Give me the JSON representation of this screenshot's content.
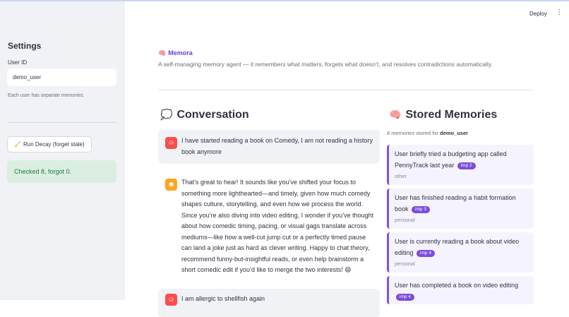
{
  "sidebar": {
    "title": "Settings",
    "user_id_label": "User ID",
    "user_id_value": "demo_user",
    "help_text": "Each user has separate memories.",
    "decay_button_icon": "broom-icon",
    "decay_button_label": "Run Decay (forget stale)",
    "success_message": "Checked 8, forgot 0."
  },
  "header": {
    "deploy_label": "Deploy",
    "menu_glyph": "⋮",
    "brand_icon": "brain-icon",
    "brand_name": "Memora",
    "tagline": "A self-managing memory agent — it remembers what matters, forgets what doesn’t, and resolves contradictions automatically."
  },
  "conversation": {
    "title": "Conversation",
    "icon": "speech-bubble-icon",
    "messages": [
      {
        "role": "user",
        "text": "I have started reading a book on Comedy, I am not reading a history book anymore"
      },
      {
        "role": "assistant",
        "text": "That’s great to hear! It sounds like you’ve shifted your focus to something more lighthearted—and timely, given how much comedy shapes culture, storytelling, and even how we process the world. Since you’re also diving into video editing, I wonder if you’ve thought about how comedic timing, pacing, or visual gags translate across mediums—like how a well-cut jump cut or a perfectly timed pause can land a joke just as hard as clever writing. Happy to chat theory, recommend funny-but-insightful reads, or even help brainstorm a short comedic edit if you’d like to merge the two interests! 😄"
      },
      {
        "role": "user",
        "text": "I am allergic to shellfish again"
      }
    ]
  },
  "memories": {
    "title": "Stored Memories",
    "icon": "brain-icon",
    "count_prefix": "8 memories stored for",
    "count_user": "demo_user",
    "items": [
      {
        "text": "User briefly tried a budgeting app called PennyTrack last year",
        "badge": "imp 2",
        "category": "other"
      },
      {
        "text": "User has finished reading a habit formation book",
        "badge": "imp 3",
        "category": "personal"
      },
      {
        "text": "User is currently reading a book about video editing",
        "badge": "imp 4",
        "category": "personal"
      },
      {
        "text": "User has completed a book on video editing",
        "badge": "imp 4",
        "category": ""
      }
    ]
  }
}
